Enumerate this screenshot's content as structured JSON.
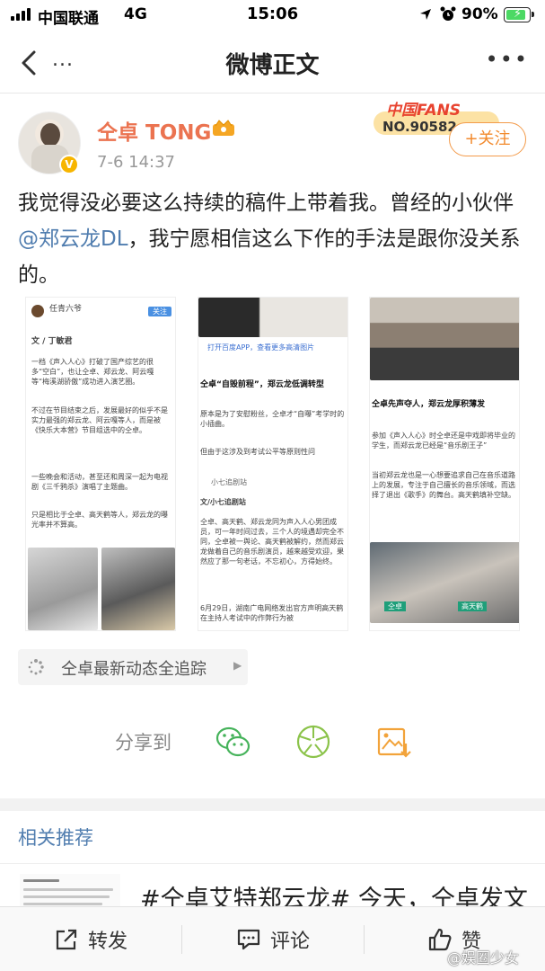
{
  "status_bar": {
    "carrier": "中国联通",
    "network": "4G",
    "time": "15:06",
    "battery": "90%"
  },
  "nav": {
    "more_label": "...",
    "title": "微博正文"
  },
  "post": {
    "author": "仝卓 TONG",
    "time": "7-6 14:37",
    "fans_badge": {
      "line1": "中国FANS",
      "line2": "NO.90582"
    },
    "follow_label": "+关注",
    "text_part1": "我觉得没必要这么持续的稿件上带着我。曾经的小伙伴",
    "mention": "@郑云龙DL",
    "text_part2": "，我宁愿相信这么下作的手法是跟你没关系的。",
    "images": [
      {
        "account": "任青六爷",
        "follow": "关注",
        "byline": "文 / 丁敏君",
        "para1": "一档《声入人心》打破了国产综艺的很多“空白”，也让仝卓、郑云龙、阿云嘎等“梅溪湖骄傲”成功进入演艺圈。",
        "para2": "不过在节目结束之后，发展最好的似乎不是实力最强的郑云龙、阿云嘎等人，而是被《快乐大本营》节目组选中的仝卓。",
        "para3": "一些晚会和活动，甚至还和周深一起为电视剧《三千鸦杀》演唱了主题曲。",
        "para4": "只是相比于仝卓、高天鹤等人，郑云龙的曝光率并不算高。"
      },
      {
        "banner": "打开百度APP，查看更多高清图片",
        "heading": "仝卓“自毁前程”，郑云龙低调转型",
        "para1": "原本是为了安慰粉丝，仝卓才“自曝”考学时的小插曲。",
        "para2": "但由于这涉及到考试公平等原则性问",
        "source": "小七追剧站",
        "byline": "文/小七追剧站",
        "para3": "仝卓、高天鹤、郑云龙同为声入人心男团成员，可一年时间过去，三个人的境遇却完全不同，仝卓被一舆论、高天鹤被解约，然而郑云龙做着自己的音乐剧演员，越来越受欢迎，果然应了那一句老话，不忘初心，方得始终。",
        "para4": "6月29日，湖南广电网络发出官方声明高天鹤在主持人考试中的作弊行为被"
      },
      {
        "heading": "仝卓先声夺人，郑云龙厚积薄发",
        "para1": "参加《声入人心》时仝卓还是中戏即将毕业的学生，而郑云龙已经是“音乐剧王子”",
        "para2": "当初郑云龙也是一心想要追求自己在音乐道路上的发展，专注于自己擅长的音乐领域，而选择了退出《歌手》的舞台。高天鹤填补空缺。",
        "tag1": "仝卓",
        "tag2": "高天鹤"
      }
    ],
    "topic_label": "仝卓最新动态全追踪"
  },
  "share": {
    "label": "分享到"
  },
  "related": {
    "title": "相关推荐",
    "item_text": "#仝卓艾特郑云龙# 今天，仝卓发文"
  },
  "toolbar": {
    "repost": "转发",
    "comment": "评论",
    "like": "赞"
  },
  "watermark": "@娱圈少女",
  "colors": {
    "accent": "#eb7350",
    "link": "#507daf",
    "follow": "#f28a2d"
  }
}
